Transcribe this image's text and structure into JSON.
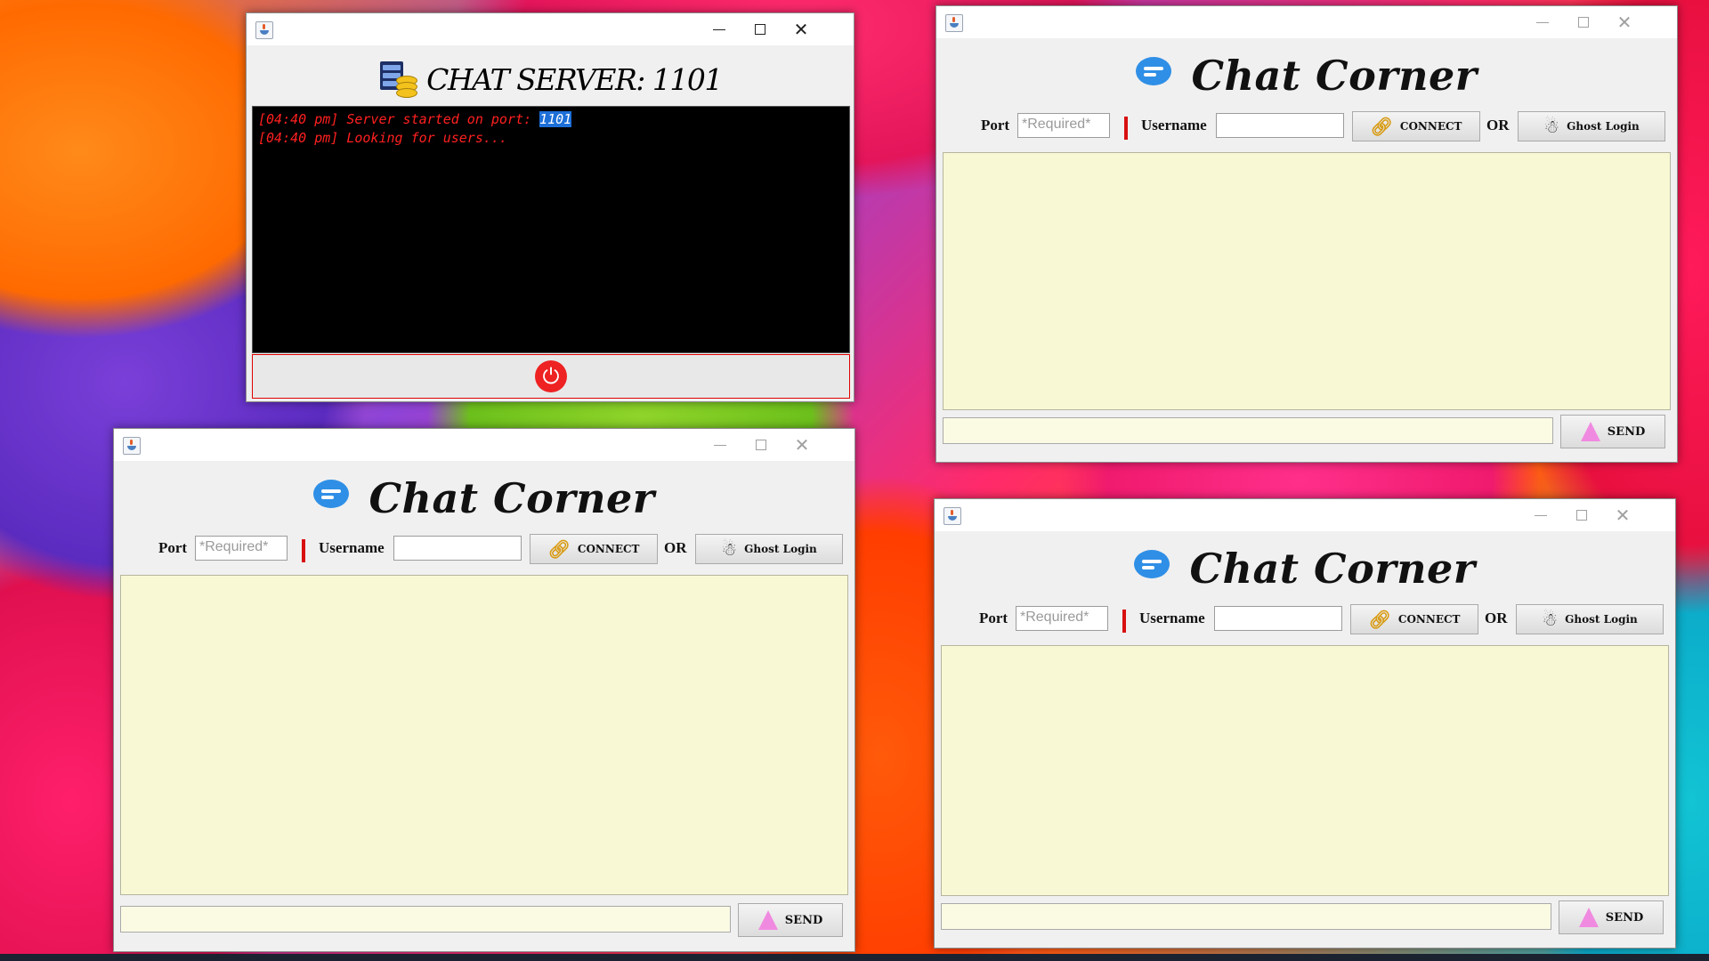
{
  "server": {
    "title": "CHAT SERVER: 1101",
    "console": {
      "line1_prefix": "[04:40 pm] Server started on port: ",
      "line1_port": "1101",
      "line2": "[04:40 pm] Looking for users..."
    },
    "power_icon": "power-icon"
  },
  "client": {
    "title": "Chat Corner",
    "port_label": "Port",
    "port_placeholder": "*Required*",
    "username_label": "Username",
    "connect_label": "CONNECT",
    "or_label": "OR",
    "ghost_label": "Ghost Login",
    "send_label": "SEND"
  },
  "colors": {
    "console_text": "#ff2020",
    "chat_area_bg": "#f8f8d4",
    "accent_red": "#d81010",
    "logo_blue": "#2f8fe6"
  }
}
